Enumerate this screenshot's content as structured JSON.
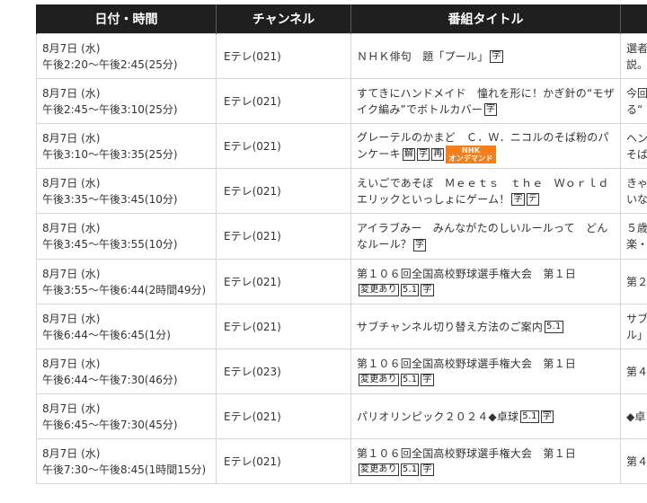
{
  "header": {
    "datetime": "日付・時間",
    "channel": "チャンネル",
    "title": "番組タイトル",
    "desc": ""
  },
  "rows": [
    {
      "date": "8月7日 (水)",
      "time": "午後2:20～午後2:45(25分)",
      "channel": "Eテレ(021)",
      "title": "ＮＨＫ俳句　題「プール」",
      "marks": [
        "字"
      ],
      "ondemand": false,
      "desc1": "選者",
      "desc2": "説。"
    },
    {
      "date": "8月7日 (水)",
      "time": "午後2:45～午後3:10(25分)",
      "channel": "Eテレ(021)",
      "title": "すてきにハンドメイド　憧れを形に！かぎ針の“モザイク編み”でボトルカバー",
      "marks": [
        "字"
      ],
      "ondemand": false,
      "desc1": "今回",
      "desc2": "る“"
    },
    {
      "date": "8月7日 (水)",
      "time": "午後3:10～午後3:35(25分)",
      "channel": "Eテレ(021)",
      "title": "グレーテルのかまど　Ｃ．Ｗ．ニコルのそば粉のパンケーキ",
      "marks": [
        "解",
        "字",
        "再"
      ],
      "ondemand": true,
      "desc1": "ヘン",
      "desc2": "そば"
    },
    {
      "date": "8月7日 (水)",
      "time": "午後3:35～午後3:45(10分)",
      "channel": "Eテレ(021)",
      "title": "えいごであそぼ　Ｍｅｅｔｓ　ｔｈｅ　Ｗｏｒｌｄ　エリックといっしょにゲーム！",
      "marks": [
        "字",
        "デ"
      ],
      "ondemand": false,
      "desc1": "きゃ",
      "desc2": "いな"
    },
    {
      "date": "8月7日 (水)",
      "time": "午後3:45～午後3:55(10分)",
      "channel": "Eテレ(021)",
      "title": "アイラブみー　みんながたのしいルールって　どんなルール？",
      "marks": [
        "字"
      ],
      "ondemand": false,
      "desc1": "５歳",
      "desc2": "楽・"
    },
    {
      "date": "8月7日 (水)",
      "time": "午後3:55～午後6:44(2時間49分)",
      "channel": "Eテレ(021)",
      "title": "第１０６回全国高校野球選手権大会　第１日",
      "marks": [
        "変更あり",
        "5.1",
        "字"
      ],
      "ondemand": false,
      "desc1": "第２",
      "desc2": ""
    },
    {
      "date": "8月7日 (水)",
      "time": "午後6:44～午後6:45(1分)",
      "channel": "Eテレ(021)",
      "title": "サブチャンネル切り替え方法のご案内",
      "marks": [
        "5.1"
      ],
      "ondemand": false,
      "desc1": "サブ",
      "desc2": "ル」"
    },
    {
      "date": "8月7日 (水)",
      "time": "午後6:44～午後7:30(46分)",
      "channel": "Eテレ(023)",
      "title": "第１０６回全国高校野球選手権大会　第１日",
      "marks": [
        "変更あり",
        "5.1",
        "字"
      ],
      "ondemand": false,
      "desc1": "第４",
      "desc2": ""
    },
    {
      "date": "8月7日 (水)",
      "time": "午後6:45～午後7:30(45分)",
      "channel": "Eテレ(021)",
      "title": "パリオリンピック２０２４◆卓球",
      "marks": [
        "5.1",
        "字"
      ],
      "ondemand": false,
      "desc1": "◆卓",
      "desc2": ""
    },
    {
      "date": "8月7日 (水)",
      "time": "午後7:30～午後8:45(1時間15分)",
      "channel": "Eテレ(021)",
      "title": "第１０６回全国高校野球選手権大会　第１日",
      "marks": [
        "変更あり",
        "5.1",
        "字"
      ],
      "ondemand": false,
      "desc1": "第４",
      "desc2": ""
    }
  ],
  "ondemand_badge": {
    "line1": "NHK",
    "line2": "オンデマンド"
  },
  "colors": {
    "header_bg": "#1f1f1f",
    "border": "#d7d7d7",
    "ondemand": "#f3801d"
  }
}
